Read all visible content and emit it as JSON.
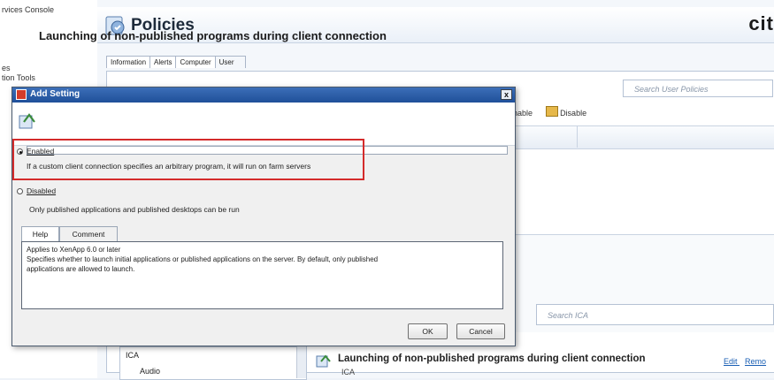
{
  "tree": {
    "items": [
      "rvices Console",
      "es",
      "tion Tools"
    ]
  },
  "header": {
    "title": "Policies",
    "logo_text": "cit"
  },
  "tabs": [
    "Information",
    "Alerts",
    "Computer",
    "User"
  ],
  "search_user_policies": {
    "placeholder": "Search User Policies"
  },
  "toolbar": {
    "enable_partial": "nable",
    "disable_label": "Disable"
  },
  "search_ica": {
    "placeholder": "Search ICA"
  },
  "lower_list": [
    "ICA",
    "Audio"
  ],
  "detail": {
    "title": "Launching of non-published programs during client connection",
    "category": "ICA",
    "edit_link": "Edit",
    "remove_link": "Remo"
  },
  "dialog": {
    "title": "Add Setting",
    "close_label": "x",
    "heading": "Launching of non-published programs during client connection",
    "enabled_label": "Enabled",
    "enabled_desc": "If a custom client connection specifies an arbitrary program, it will run on farm servers",
    "disabled_label": "Disabled",
    "disabled_desc": "Only published applications and published desktops can be run",
    "help_tab": "Help",
    "comment_tab": "Comment",
    "help_lines": [
      "Applies to XenApp 6.0 or later",
      "Specifies whether to launch initial applications or published applications on the server. By default, only published",
      "applications are allowed to launch."
    ],
    "ok_label": "OK",
    "cancel_label": "Cancel",
    "selected_option": "Enabled"
  },
  "colors": {
    "highlight_box": "#d42b2b",
    "title_bar": "#1f4f99"
  }
}
